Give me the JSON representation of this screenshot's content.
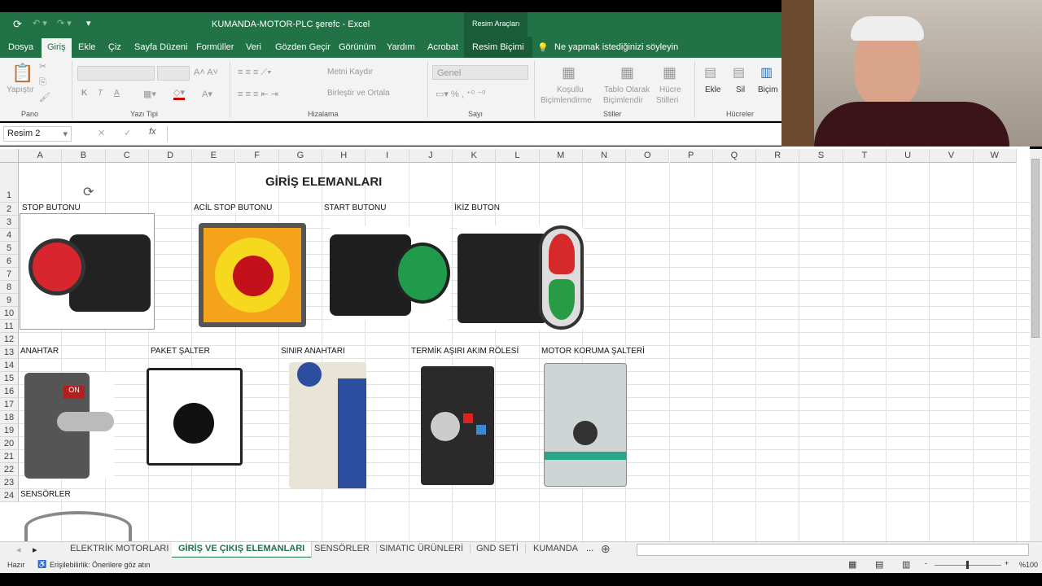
{
  "window": {
    "title": "KUMANDA-MOTOR-PLC şerefc  -  Excel",
    "context_group": "Resim Araçları"
  },
  "tabs": [
    "Dosya",
    "Giriş",
    "Ekle",
    "Çiz",
    "Sayfa Düzeni",
    "Formüller",
    "Veri",
    "Gözden Geçir",
    "Görünüm",
    "Yardım",
    "Acrobat",
    "Resim Biçimi"
  ],
  "tell_me": "Ne yapmak istediğinizi söyleyin",
  "ribbon": {
    "paste": "Yapıştır",
    "groups": [
      "Pano",
      "Yazı Tipi",
      "Hizalama",
      "Sayı",
      "Stiller",
      "Hücreler"
    ],
    "wrap_text": "Metni Kaydır",
    "merge": "Birleştir ve Ortala",
    "number_format": "Genel",
    "conditional": [
      "Koşullu",
      "Biçimlendirme"
    ],
    "table": [
      "Tablo Olarak",
      "Biçimlendir"
    ],
    "cell_styles": [
      "Hücre",
      "Stilleri"
    ],
    "insert": "Ekle",
    "delete": "Sil",
    "format": "Biçim",
    "bold": "K",
    "italic": "T",
    "underline": "A"
  },
  "formula_bar": {
    "name_box": "Resim 2",
    "fx": "fx",
    "value": ""
  },
  "columns": [
    "A",
    "B",
    "C",
    "D",
    "E",
    "F",
    "G",
    "H",
    "I",
    "J",
    "K",
    "L",
    "M",
    "N",
    "O",
    "P",
    "Q",
    "R",
    "S",
    "T",
    "U",
    "V",
    "W"
  ],
  "rows": [
    "1",
    "2",
    "3",
    "4",
    "5",
    "6",
    "7",
    "8",
    "9",
    "10",
    "11",
    "12",
    "13",
    "14",
    "15",
    "16",
    "17",
    "18",
    "19",
    "20",
    "21",
    "22",
    "23",
    "24"
  ],
  "cells": {
    "title": "GİRİŞ ELEMANLARI",
    "labels": [
      "STOP BUTONU",
      "ACİL STOP BUTONU",
      "START BUTONU",
      "İKİZ BUTON",
      "ANAHTAR",
      "PAKET ŞALTER",
      "SINIR ANAHTARI",
      "TERMİK AŞIRI AKIM RÖLESİ",
      "MOTOR KORUMA ŞALTERİ",
      "SENSÖRLER"
    ]
  },
  "sheet_tabs": [
    "ELEKTRİK MOTORLARI",
    "GİRİŞ VE ÇIKIŞ ELEMANLARI",
    "SENSÖRLER",
    "SIMATIC ÜRÜNLERİ",
    "GND SETİ",
    "KUMANDA",
    "..."
  ],
  "status": {
    "ready": "Hazır",
    "accessibility": "Erişilebilirlik: Önerilere göz atın",
    "zoom": "%100"
  }
}
